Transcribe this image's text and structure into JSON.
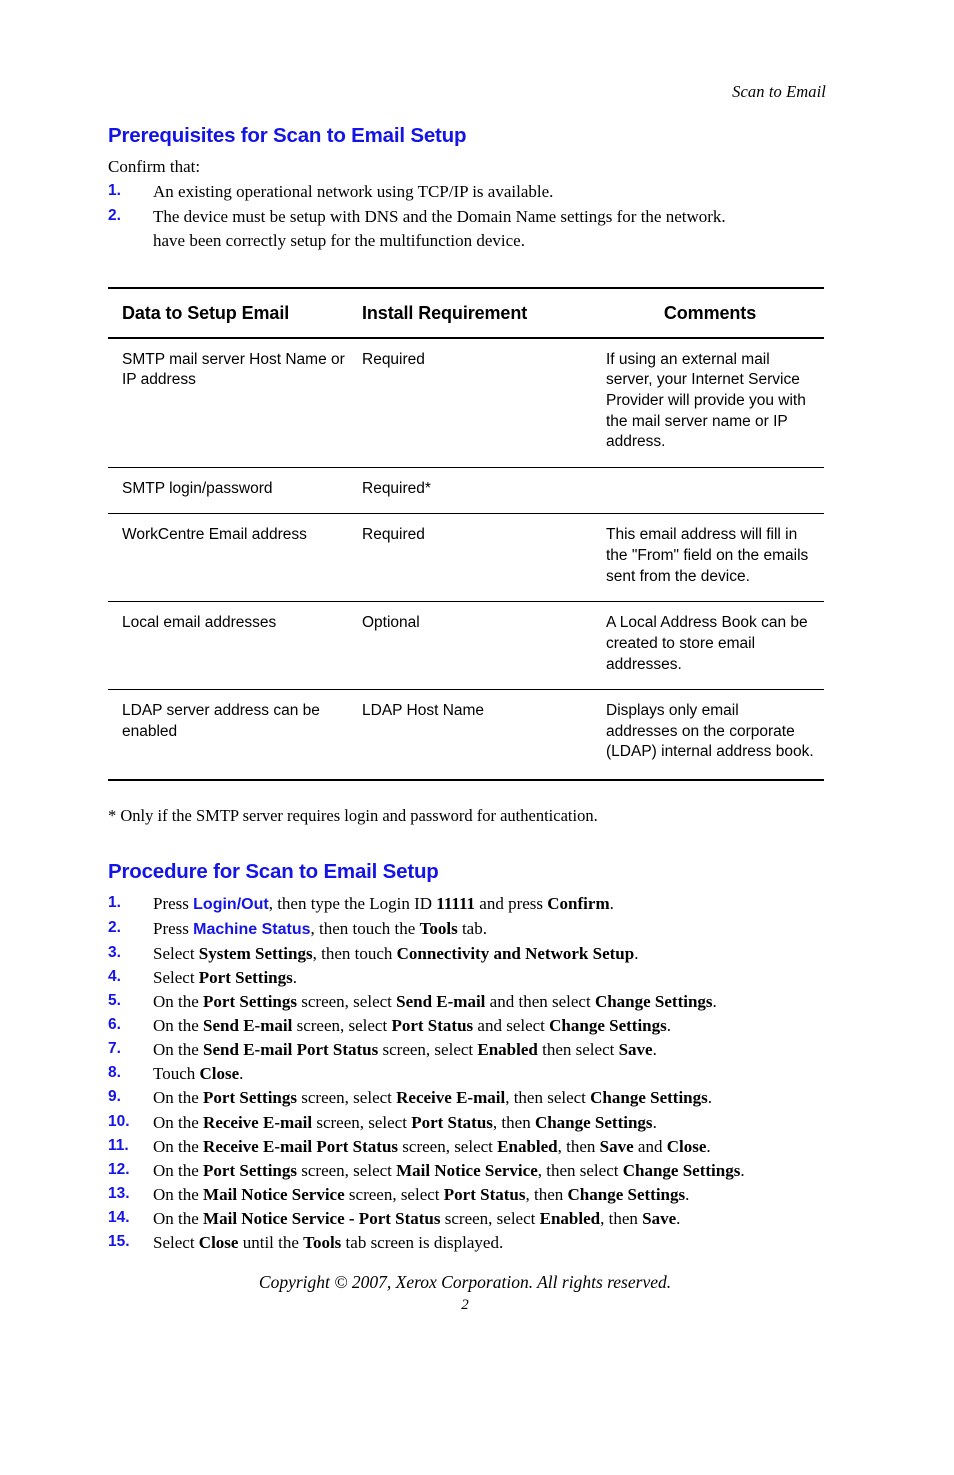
{
  "running_head": "Scan to Email",
  "prerequisites": {
    "heading": "Prerequisites for Scan to Email Setup",
    "lead": "Confirm that:",
    "items": [
      {
        "num": "1.",
        "text": "An existing operational network using TCP/IP is available."
      },
      {
        "num": "2.",
        "text": "The device must be setup with DNS and the Domain Name settings for the network.",
        "cont": "have been correctly setup for the multifunction device."
      }
    ]
  },
  "table": {
    "headers": [
      "Data to Setup Email",
      "Install Requirement",
      "Comments"
    ],
    "rows": [
      {
        "data": "SMTP mail server Host Name or IP address",
        "requirement": "Required",
        "comments": "If using an external mail server, your Internet Service Provider will provide you with the mail server name or IP address."
      },
      {
        "data": "SMTP login/password",
        "requirement": "Required*",
        "comments": ""
      },
      {
        "data": "WorkCentre Email address",
        "requirement": "Required",
        "comments": "This email address will fill in the \"From\" field on the emails sent from the device."
      },
      {
        "data": "Local email addresses",
        "requirement": "Optional",
        "comments": "A Local Address Book can be created to store email addresses."
      },
      {
        "data": "LDAP server address can be enabled",
        "requirement": "LDAP Host Name",
        "comments": "Displays only email addresses on the corporate (LDAP) internal address book."
      }
    ]
  },
  "footnote": "* Only if the SMTP server requires login and password for authentication.",
  "procedure": {
    "heading": "Procedure for Scan to Email Setup",
    "steps": [
      {
        "num": "1.",
        "parts": [
          {
            "t": "Press ",
            "s": "plain"
          },
          {
            "t": "Login/Out",
            "s": "blue"
          },
          {
            "t": ", then type the Login ID ",
            "s": "plain"
          },
          {
            "t": "11111",
            "s": "bold"
          },
          {
            "t": " and press ",
            "s": "plain"
          },
          {
            "t": "Confirm",
            "s": "bold"
          },
          {
            "t": ".",
            "s": "plain"
          }
        ]
      },
      {
        "num": "2.",
        "parts": [
          {
            "t": "Press ",
            "s": "plain"
          },
          {
            "t": "Machine Status",
            "s": "blue"
          },
          {
            "t": ", then touch the ",
            "s": "plain"
          },
          {
            "t": "Tools",
            "s": "bold"
          },
          {
            "t": " tab.",
            "s": "plain"
          }
        ]
      },
      {
        "num": "3.",
        "parts": [
          {
            "t": "Select ",
            "s": "plain"
          },
          {
            "t": "System Settings",
            "s": "bold"
          },
          {
            "t": ", then touch ",
            "s": "plain"
          },
          {
            "t": "Connectivity and Network Setup",
            "s": "bold"
          },
          {
            "t": ".",
            "s": "plain"
          }
        ]
      },
      {
        "num": "4.",
        "parts": [
          {
            "t": "Select ",
            "s": "plain"
          },
          {
            "t": "Port Settings",
            "s": "bold"
          },
          {
            "t": ".",
            "s": "plain"
          }
        ]
      },
      {
        "num": "5.",
        "parts": [
          {
            "t": "On the ",
            "s": "plain"
          },
          {
            "t": "Port Settings",
            "s": "bold"
          },
          {
            "t": " screen, select ",
            "s": "plain"
          },
          {
            "t": "Send E-mail",
            "s": "bold"
          },
          {
            "t": " and then select ",
            "s": "plain"
          },
          {
            "t": "Change Settings",
            "s": "bold"
          },
          {
            "t": ".",
            "s": "plain"
          }
        ]
      },
      {
        "num": "6.",
        "parts": [
          {
            "t": "On the ",
            "s": "plain"
          },
          {
            "t": "Send E-mail",
            "s": "bold"
          },
          {
            "t": " screen, select ",
            "s": "plain"
          },
          {
            "t": "Port Status",
            "s": "bold"
          },
          {
            "t": " and select ",
            "s": "plain"
          },
          {
            "t": "Change Settings",
            "s": "bold"
          },
          {
            "t": ".",
            "s": "plain"
          }
        ]
      },
      {
        "num": "7.",
        "parts": [
          {
            "t": "On the ",
            "s": "plain"
          },
          {
            "t": "Send E-mail Port Status",
            "s": "bold"
          },
          {
            "t": " screen, select ",
            "s": "plain"
          },
          {
            "t": "Enabled",
            "s": "bold"
          },
          {
            "t": " then select ",
            "s": "plain"
          },
          {
            "t": "Save",
            "s": "bold"
          },
          {
            "t": ".",
            "s": "plain"
          }
        ]
      },
      {
        "num": "8.",
        "parts": [
          {
            "t": "Touch ",
            "s": "plain"
          },
          {
            "t": "Close",
            "s": "bold"
          },
          {
            "t": ".",
            "s": "plain"
          }
        ]
      },
      {
        "num": "9.",
        "parts": [
          {
            "t": "On the ",
            "s": "plain"
          },
          {
            "t": "Port Settings",
            "s": "bold"
          },
          {
            "t": " screen, select ",
            "s": "plain"
          },
          {
            "t": "Receive E-mail",
            "s": "bold"
          },
          {
            "t": ", then select ",
            "s": "plain"
          },
          {
            "t": "Change Settings",
            "s": "bold"
          },
          {
            "t": ".",
            "s": "plain"
          }
        ]
      },
      {
        "num": "10.",
        "parts": [
          {
            "t": "On the ",
            "s": "plain"
          },
          {
            "t": "Receive E-mail",
            "s": "bold"
          },
          {
            "t": " screen, select ",
            "s": "plain"
          },
          {
            "t": "Port Status",
            "s": "bold"
          },
          {
            "t": ", then ",
            "s": "plain"
          },
          {
            "t": "Change Settings",
            "s": "bold"
          },
          {
            "t": ".",
            "s": "plain"
          }
        ]
      },
      {
        "num": "11.",
        "parts": [
          {
            "t": "On the ",
            "s": "plain"
          },
          {
            "t": "Receive E-mail Port Status",
            "s": "bold"
          },
          {
            "t": " screen, select ",
            "s": "plain"
          },
          {
            "t": "Enabled",
            "s": "bold"
          },
          {
            "t": ", then ",
            "s": "plain"
          },
          {
            "t": "Save",
            "s": "bold"
          },
          {
            "t": " and ",
            "s": "plain"
          },
          {
            "t": "Close",
            "s": "bold"
          },
          {
            "t": ".",
            "s": "plain"
          }
        ]
      },
      {
        "num": "12.",
        "parts": [
          {
            "t": "On the ",
            "s": "plain"
          },
          {
            "t": "Port Settings",
            "s": "bold"
          },
          {
            "t": " screen, select ",
            "s": "plain"
          },
          {
            "t": "Mail Notice Service",
            "s": "bold"
          },
          {
            "t": ", then select ",
            "s": "plain"
          },
          {
            "t": "Change Settings",
            "s": "bold"
          },
          {
            "t": ".",
            "s": "plain"
          }
        ]
      },
      {
        "num": "13.",
        "parts": [
          {
            "t": "On the ",
            "s": "plain"
          },
          {
            "t": "Mail Notice Service",
            "s": "bold"
          },
          {
            "t": " screen, select ",
            "s": "plain"
          },
          {
            "t": "Port Status",
            "s": "bold"
          },
          {
            "t": ", then ",
            "s": "plain"
          },
          {
            "t": "Change Settings",
            "s": "bold"
          },
          {
            "t": ".",
            "s": "plain"
          }
        ]
      },
      {
        "num": "14.",
        "parts": [
          {
            "t": "On the ",
            "s": "plain"
          },
          {
            "t": "Mail Notice Service - Port Status",
            "s": "bold"
          },
          {
            "t": " screen, select ",
            "s": "plain"
          },
          {
            "t": "Enabled",
            "s": "bold"
          },
          {
            "t": ", then ",
            "s": "plain"
          },
          {
            "t": "Save",
            "s": "bold"
          },
          {
            "t": ".",
            "s": "plain"
          }
        ]
      },
      {
        "num": "15.",
        "parts": [
          {
            "t": "Select ",
            "s": "plain"
          },
          {
            "t": "Close",
            "s": "bold"
          },
          {
            "t": " until the ",
            "s": "plain"
          },
          {
            "t": "Tools",
            "s": "bold"
          },
          {
            "t": " tab screen is displayed.",
            "s": "plain"
          }
        ]
      }
    ]
  },
  "footer": {
    "copyright": "Copyright © 2007, Xerox Corporation. All rights reserved.",
    "page_number": "2"
  },
  "colors": {
    "heading_blue": "#1414e6",
    "text_black": "#000000",
    "background": "#ffffff"
  }
}
